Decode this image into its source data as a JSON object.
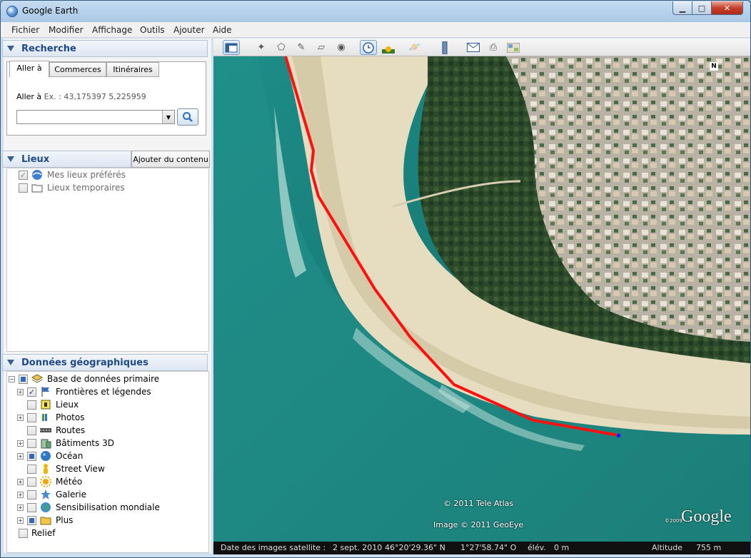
{
  "window": {
    "title": "Google Earth",
    "min": "▁",
    "max": "□",
    "close": "✕"
  },
  "menu": [
    "Fichier",
    "Modifier",
    "Affichage",
    "Outils",
    "Ajouter",
    "Aide"
  ],
  "search": {
    "title": "Recherche",
    "tabs": [
      "Aller à",
      "Commerces",
      "Itinéraires"
    ],
    "hint_label": "Aller à",
    "hint_example": "Ex. : 43,175397 5,225959",
    "input_value": "",
    "input_placeholder": ""
  },
  "places": {
    "title": "Lieux",
    "add_button": "Ajouter du contenu",
    "items": [
      {
        "label": "Mes lieux préférés",
        "checked": true
      },
      {
        "label": "Lieux temporaires",
        "checked": false
      }
    ]
  },
  "layers": {
    "title": "Données géographiques",
    "root": "Base de données primaire",
    "items": [
      {
        "label": "Frontières et légendes",
        "state": "checked",
        "expandable": true,
        "icon": "flag-icon"
      },
      {
        "label": "Lieux",
        "state": "off",
        "expandable": false,
        "icon": "place-icon"
      },
      {
        "label": "Photos",
        "state": "off",
        "expandable": true,
        "icon": "photo-icon"
      },
      {
        "label": "Routes",
        "state": "off",
        "expandable": false,
        "icon": "road-icon"
      },
      {
        "label": "Bâtiments 3D",
        "state": "off",
        "expandable": true,
        "icon": "building-icon"
      },
      {
        "label": "Océan",
        "state": "partial",
        "expandable": true,
        "icon": "ocean-icon"
      },
      {
        "label": "Street View",
        "state": "off",
        "expandable": false,
        "icon": "pegman-icon"
      },
      {
        "label": "Météo",
        "state": "off",
        "expandable": true,
        "icon": "weather-icon"
      },
      {
        "label": "Galerie",
        "state": "off",
        "expandable": true,
        "icon": "star-icon"
      },
      {
        "label": "Sensibilisation mondiale",
        "state": "off",
        "expandable": true,
        "icon": "globe-icon"
      },
      {
        "label": "Plus",
        "state": "partial",
        "expandable": true,
        "icon": "folder-icon"
      },
      {
        "label": "Relief",
        "state": "off",
        "expandable": false,
        "icon": ""
      }
    ]
  },
  "map": {
    "credit1": "© 2011 Tele Atlas",
    "credit2": "Image © 2011 GeoEye",
    "logo": "Google",
    "logo_year": "©2009",
    "north": "N"
  },
  "status": {
    "date_label": "Date des images satellite :",
    "date": "2 sept. 2010",
    "lat": "46°20'29.36\" N",
    "lon": "1°27'58.74\" O",
    "elev_label": "élév.",
    "elev": "0 m",
    "alt_label": "Altitude",
    "alt": "755 m"
  }
}
